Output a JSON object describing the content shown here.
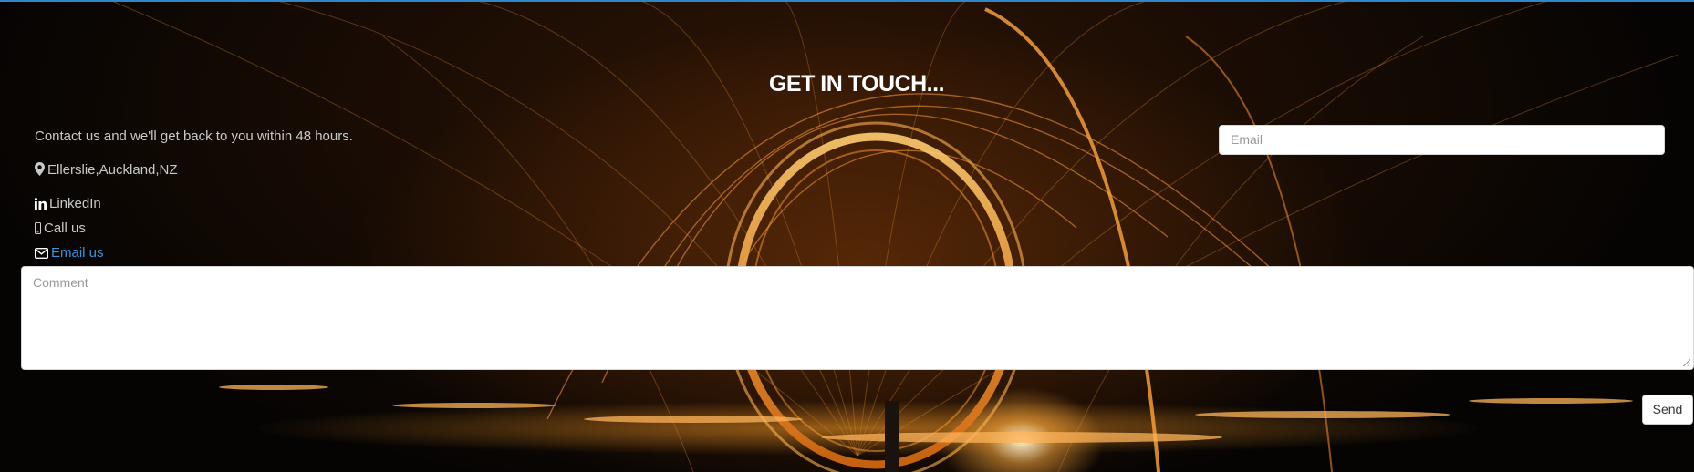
{
  "heading": "GET IN TOUCH...",
  "contact": {
    "intro": "Contact us and we'll get back to you within 48 hours.",
    "location": "Ellerslie,Auckland,NZ",
    "linkedin": "LinkedIn",
    "call": "Call us",
    "email": "Email us"
  },
  "form": {
    "email_placeholder": "Email",
    "comment_placeholder": "Comment",
    "send_label": "Send"
  },
  "icons": {
    "location": "map-marker-icon",
    "linkedin": "linkedin-icon",
    "call": "phone-icon",
    "email": "envelope-icon"
  },
  "colors": {
    "link": "#3b93e0",
    "heading": "#ffffff",
    "top_border": "#2f86c9"
  }
}
